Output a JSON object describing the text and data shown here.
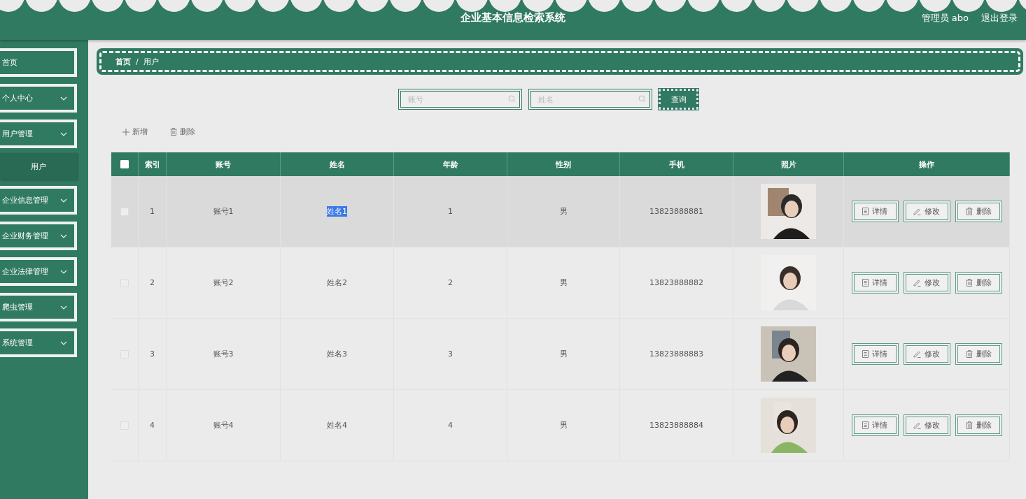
{
  "header": {
    "title": "企业基本信息检索系统",
    "user": "管理员 abo",
    "logout": "退出登录"
  },
  "sidebar": {
    "items": [
      {
        "label": "首页",
        "kind": "link"
      },
      {
        "label": "个人中心",
        "kind": "menu"
      },
      {
        "label": "用户管理",
        "kind": "menu",
        "children": [
          {
            "label": "用户",
            "selected": true
          }
        ]
      },
      {
        "label": "企业信息管理",
        "kind": "menu"
      },
      {
        "label": "企业财务管理",
        "kind": "menu"
      },
      {
        "label": "企业法律管理",
        "kind": "menu"
      },
      {
        "label": "爬虫管理",
        "kind": "menu"
      },
      {
        "label": "系统管理",
        "kind": "menu"
      }
    ]
  },
  "breadcrumb": [
    "首页",
    "/",
    "用户"
  ],
  "search": {
    "fields": [
      {
        "placeholder": "账号"
      },
      {
        "placeholder": "姓名"
      }
    ],
    "button": "查询"
  },
  "actions": [
    {
      "label": "新增",
      "kind": "add"
    },
    {
      "label": "删除",
      "kind": "delete"
    }
  ],
  "table": {
    "header_checked": false,
    "columns": [
      "索引",
      "账号",
      "姓名",
      "年龄",
      "性别",
      "手机",
      "照片",
      "操作"
    ],
    "rows": [
      {
        "checked": false,
        "hovered": true,
        "index": "1",
        "account": "账号1",
        "name": "姓名1",
        "name_selected": true,
        "age": "1",
        "gender": "男",
        "phone": "13823888881",
        "photo": {
          "kind": "picture"
        },
        "buttons": [
          {
            "label": "详情",
            "kind": "detail"
          },
          {
            "label": "修改",
            "kind": "edit"
          },
          {
            "label": "删除",
            "kind": "delete"
          }
        ]
      },
      {
        "checked": false,
        "hovered": false,
        "index": "2",
        "account": "账号2",
        "name": "姓名2",
        "name_selected": false,
        "age": "2",
        "gender": "男",
        "phone": "13823888882",
        "photo": {
          "kind": "picture"
        },
        "buttons": [
          {
            "label": "详情",
            "kind": "detail"
          },
          {
            "label": "修改",
            "kind": "edit"
          },
          {
            "label": "删除",
            "kind": "delete"
          }
        ]
      },
      {
        "checked": false,
        "hovered": false,
        "index": "3",
        "account": "账号3",
        "name": "姓名3",
        "name_selected": false,
        "age": "3",
        "gender": "男",
        "phone": "13823888883",
        "photo": {
          "kind": "picture"
        },
        "buttons": [
          {
            "label": "详情",
            "kind": "detail"
          },
          {
            "label": "修改",
            "kind": "edit"
          },
          {
            "label": "删除",
            "kind": "delete"
          }
        ]
      },
      {
        "checked": false,
        "hovered": false,
        "index": "4",
        "account": "账号4",
        "name": "姓名4",
        "name_selected": false,
        "age": "4",
        "gender": "男",
        "phone": "13823888884",
        "photo": {
          "kind": "picture"
        },
        "buttons": [
          {
            "label": "详情",
            "kind": "detail"
          },
          {
            "label": "修改",
            "kind": "edit"
          },
          {
            "label": "删除",
            "kind": "delete"
          }
        ]
      }
    ]
  }
}
